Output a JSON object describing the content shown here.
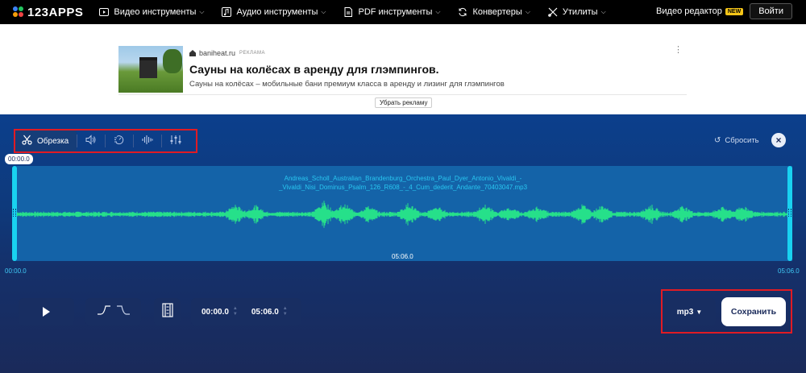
{
  "brand": {
    "name": "123APPS"
  },
  "nav": {
    "items": [
      {
        "label": "Видео инструменты",
        "icon": "video-icon"
      },
      {
        "label": "Аудио инструменты",
        "icon": "music-icon"
      },
      {
        "label": "PDF инструменты",
        "icon": "pdf-icon"
      },
      {
        "label": "Конвертеры",
        "icon": "convert-icon"
      },
      {
        "label": "Утилиты",
        "icon": "tools-icon"
      }
    ],
    "video_editor": "Видео редактор",
    "new_badge": "NEW",
    "login": "Войти"
  },
  "ad": {
    "source": "baniheat.ru",
    "ad_label": "РЕКЛАМА",
    "title": "Сауны на колёсах в аренду для глэмпингов.",
    "description": "Сауны на колёсах – мобильные бани премиум класса в аренду и лизинг для глэмпингов",
    "remove": "Убрать рекламу"
  },
  "editor": {
    "toolbar": {
      "trim_label": "Обрезка",
      "tools": [
        "scissors-icon",
        "volume-icon",
        "speed-icon",
        "equalizer-wave-icon",
        "sliders-icon"
      ]
    },
    "reset": "Сбросить",
    "start_bubble": "00:00.0",
    "filename_line1": "Andreas_Scholl_Australian_Brandenburg_Orchestra_Paul_Dyer_Antonio_Vivaldi_-",
    "filename_line2": "_Vivaldi_Nisi_Dominus_Psalm_126_R608_-_4_Cum_dederit_Andante_70403047.mp3",
    "duration_center": "05:06.0",
    "left_time": "00:00.0",
    "right_time": "05:06.0",
    "start_time": "00:00.0",
    "end_time": "05:06.0",
    "format": "mp3",
    "save": "Сохранить"
  },
  "colors": {
    "wave": "#26e08a",
    "handle": "#19d2f0",
    "highlight": "#e01b24",
    "new_badge": "#f5c518"
  }
}
